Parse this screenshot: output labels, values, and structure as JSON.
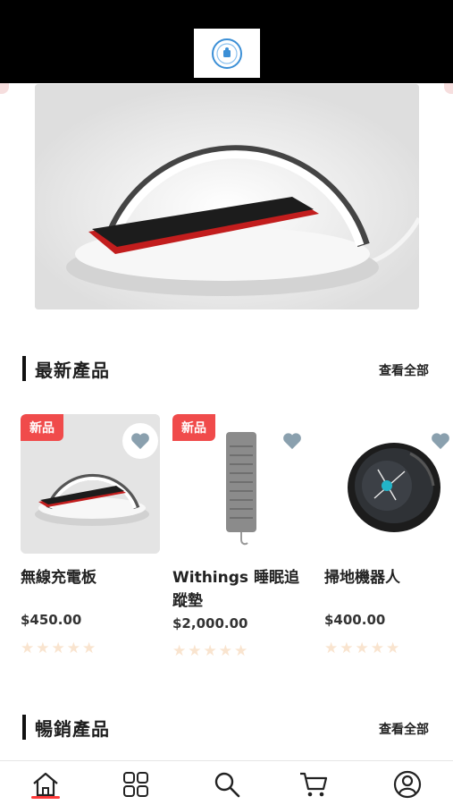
{
  "header": {
    "logo_icon": "brand-logo-icon"
  },
  "hero": {
    "image": "wireless-charger-lamp-photo"
  },
  "new_products": {
    "title": "最新產品",
    "view_all": "查看全部",
    "items": [
      {
        "name": "無線充電板",
        "price": "$450.00",
        "badge": "新品",
        "rating": 0,
        "image": "wireless-charger-photo"
      },
      {
        "name": "Withings 睡眠追蹤墊",
        "price": "$2,000.00",
        "badge": "新品",
        "rating": 0,
        "image": "sleep-tracking-pad-photo"
      },
      {
        "name": "掃地機器人",
        "price": "$400.00",
        "badge": "",
        "rating": 0,
        "image": "robot-vacuum-photo"
      }
    ]
  },
  "best_sellers": {
    "title": "暢銷產品",
    "view_all": "查看全部"
  },
  "tabbar": {
    "items": [
      {
        "icon": "home-icon",
        "active": true
      },
      {
        "icon": "categories-icon",
        "active": false
      },
      {
        "icon": "search-icon",
        "active": false
      },
      {
        "icon": "cart-icon",
        "active": false
      },
      {
        "icon": "account-icon",
        "active": false
      }
    ],
    "accent": "#ff3a3a"
  },
  "colors": {
    "badge": "#f04b4b",
    "heart": "#8aa0ae",
    "star_empty": "#f9e4cf"
  }
}
